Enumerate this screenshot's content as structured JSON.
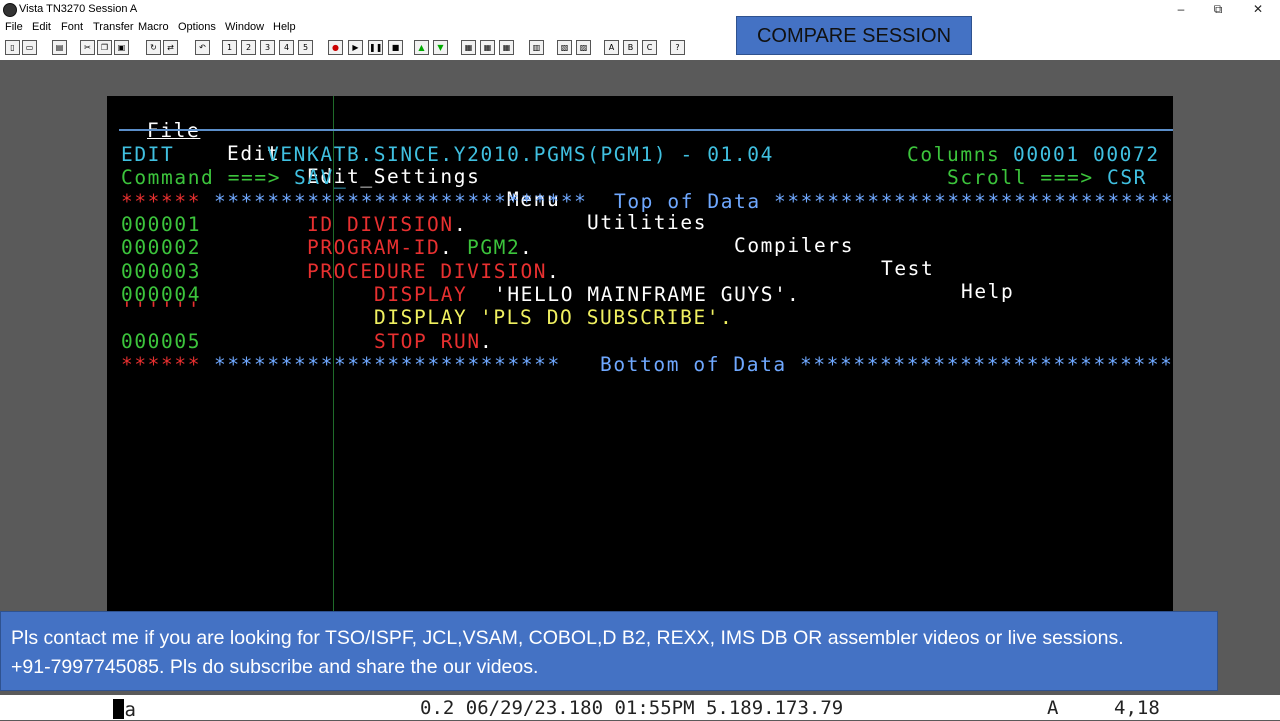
{
  "window": {
    "title": "Vista TN3270 Session A",
    "minimize": "–",
    "maximize": "⧉",
    "close": "✕"
  },
  "menubar": [
    "File",
    "Edit",
    "Font",
    "Transfer",
    "Macro",
    "Options",
    "Window",
    "Help"
  ],
  "toolbar": {
    "play_labels": [
      "1",
      "2",
      "3",
      "4",
      "5"
    ],
    "letter_labels": [
      "A",
      "B",
      "C"
    ],
    "help": "?"
  },
  "banner": "COMPARE SESSION",
  "ispf": {
    "pulldown": [
      "File",
      "Edit",
      "Edit_Settings",
      "Menu",
      "Utilities",
      "Compilers",
      "Test",
      "Help"
    ],
    "mode": "EDIT",
    "dataset": "VENKATB.SINCE.Y2010.PGMS(PGM1) - 01.04",
    "columns_label": "Columns",
    "columns_from": "00001",
    "columns_to": "00072",
    "command_label": "Command ===>",
    "command_value": "SAV_",
    "scroll_label": "Scroll ===>",
    "scroll_value": "CSR",
    "top_marker": "******",
    "top_stars_left": "****************************",
    "top_text": "Top of Data",
    "top_stars_right": "*******************************",
    "lines": [
      {
        "num": "000001",
        "code": "ID DIVISION",
        "dot": "."
      },
      {
        "num": "000002",
        "code": "PROGRAM-ID",
        "dot": ".",
        "arg": "PGM2",
        "dot2": "."
      },
      {
        "num": "000003",
        "code": "PROCEDURE DIVISION",
        "dot": "."
      },
      {
        "num": "000004",
        "kw": "DISPLAY",
        "lit": "'HELLO MAINFRAME GUYS'",
        "dot": "."
      },
      {
        "num": "''''''",
        "kw": "DISPLAY",
        "lit": "'PLS DO SUBSCRIBE'",
        "dot": "."
      },
      {
        "num": "000005",
        "kw": "STOP RUN",
        "dot": "."
      }
    ],
    "bottom_marker": "******",
    "bottom_stars_left": "**************************",
    "bottom_text": "Bottom of Data",
    "bottom_stars_right": "*****************************"
  },
  "footer_message": {
    "line1": "Pls contact me if you are looking for TSO/ISPF, JCL,VSAM, COBOL,D B2, REXX, IMS DB OR assembler videos or live sessions.",
    "line2": "+91-7997745085. Pls do subscribe and share the our videos."
  },
  "oia": {
    "left": "Ma",
    "center": "0.2 06/29/23.180 01:55PM 5.189.173.79",
    "mode": "A",
    "cursor": "4,18"
  }
}
